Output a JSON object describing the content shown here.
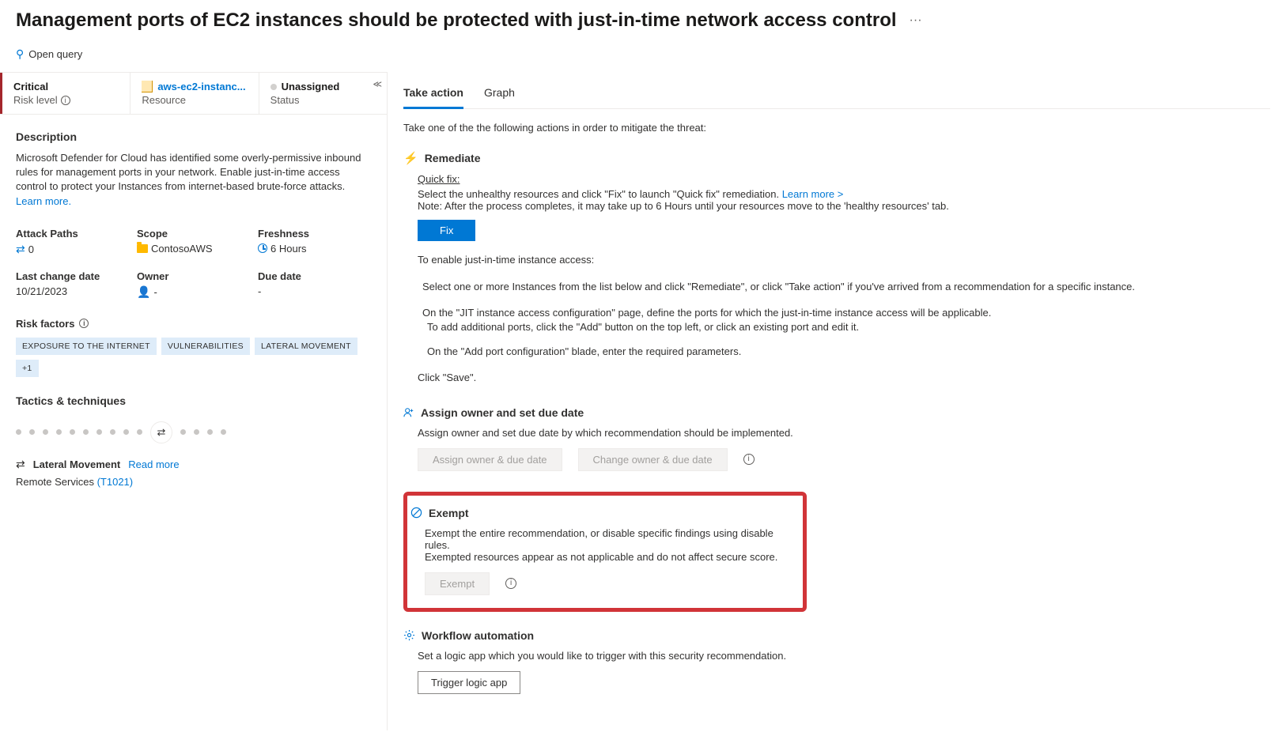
{
  "header": {
    "title": "Management ports of EC2 instances should be protected with just-in-time network access control",
    "open_query": "Open query"
  },
  "summary": {
    "risk_value": "Critical",
    "risk_label": "Risk level",
    "resource_value": "aws-ec2-instanc...",
    "resource_label": "Resource",
    "status_value": "Unassigned",
    "status_label": "Status"
  },
  "details": {
    "description_title": "Description",
    "description_text": "Microsoft Defender for Cloud has identified some overly-permissive inbound rules for management ports in your network. Enable just-in-time access control to protect your Instances from internet-based brute-force attacks. ",
    "learn_more": "Learn more.",
    "attack_paths_label": "Attack Paths",
    "attack_paths_value": "0",
    "scope_label": "Scope",
    "scope_value": "ContosoAWS",
    "freshness_label": "Freshness",
    "freshness_value": "6 Hours",
    "last_change_label": "Last change date",
    "last_change_value": "10/21/2023",
    "owner_label": "Owner",
    "owner_value": "-",
    "due_date_label": "Due date",
    "due_date_value": "-",
    "risk_factors_label": "Risk factors",
    "tags": [
      "EXPOSURE TO THE INTERNET",
      "VULNERABILITIES",
      "LATERAL MOVEMENT"
    ],
    "tag_more": "+1",
    "tactics_label": "Tactics & techniques",
    "lateral_label": "Lateral Movement",
    "read_more": "Read more",
    "remote_services": "Remote Services ",
    "remote_services_link": "(T1021)"
  },
  "right": {
    "tabs": {
      "take_action": "Take action",
      "graph": "Graph"
    },
    "intro": "Take one of the the following actions in order to mitigate the threat:",
    "remediate": {
      "title": "Remediate",
      "quick_fix": "Quick fix:",
      "line1": "Select the unhealthy resources and click \"Fix\" to launch \"Quick fix\" remediation. ",
      "learn_more": "Learn more >",
      "line2": "Note: After the process completes, it may take up to 6 Hours until your resources move to the 'healthy resources' tab.",
      "fix_btn": "Fix",
      "enable": "To enable just-in-time instance access:",
      "step1": "Select one or more Instances from the list below and click \"Remediate\", or click \"Take action\" if you've arrived from a recommendation for a specific instance.",
      "step2a": "On the \"JIT instance access configuration\" page, define the ports for which the just-in-time instance access will be applicable.",
      "step2b": "To add additional ports, click the \"Add\" button on the top left, or click an existing port and edit it.",
      "step3": "On the \"Add port configuration\" blade, enter the required parameters.",
      "step4": "Click \"Save\"."
    },
    "assign": {
      "title": "Assign owner and set due date",
      "desc": "Assign owner and set due date by which recommendation should be implemented.",
      "btn1": "Assign owner & due date",
      "btn2": "Change owner & due date"
    },
    "exempt": {
      "title": "Exempt",
      "desc1": "Exempt the entire recommendation, or disable specific findings using disable rules.",
      "desc2": "Exempted resources appear as not applicable and do not affect secure score.",
      "btn": "Exempt"
    },
    "workflow": {
      "title": "Workflow automation",
      "desc": "Set a logic app which you would like to trigger with this security recommendation.",
      "btn": "Trigger logic app"
    }
  }
}
